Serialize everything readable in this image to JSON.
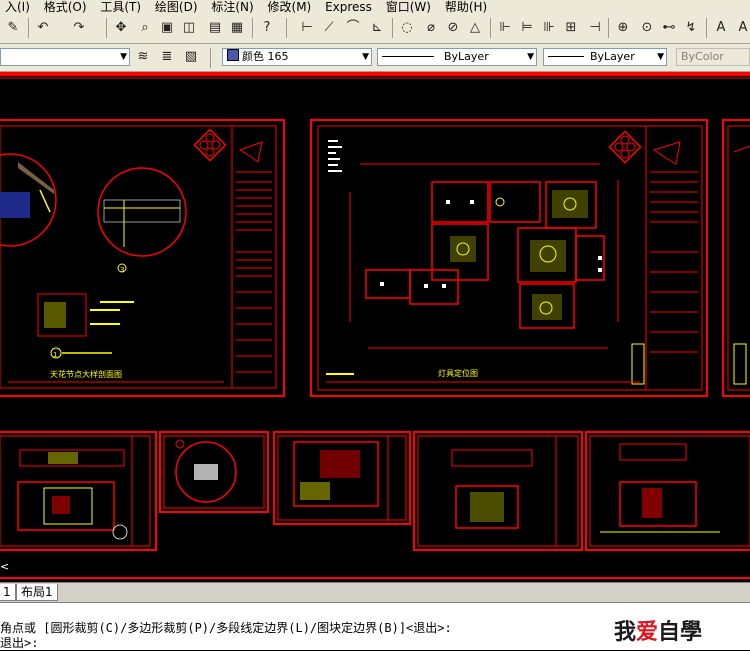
{
  "menubar": {
    "items": [
      "入(I)",
      "格式(O)",
      "工具(T)",
      "绘图(D)",
      "标注(N)",
      "修改(M)",
      "Express",
      "窗口(W)",
      "帮助(H)"
    ]
  },
  "toolbar2": {
    "color_label": "颜色 165",
    "linetype_label": "ByLayer",
    "lineweight_label": "ByLayer",
    "plotstyle_label": "ByColor"
  },
  "sheets": {
    "sheet1_title": "天花节点大样剖面图",
    "sheet2_title": "灯具定位图",
    "callout_3": "3",
    "callout_1": "1"
  },
  "tabs": {
    "tab1": "1",
    "layout1": "布局1"
  },
  "command": {
    "line1": "角点或 [圆形裁剪(C)/多边形裁剪(P)/多段线定边界(L)/图块定边界(B)]<退出>:",
    "line2": "退出>:"
  },
  "watermark": {
    "part1": "我",
    "heart": "爱",
    "part2": "自學"
  },
  "colors": {
    "cad_red": "#ff0000",
    "cad_yellow": "#ffff00",
    "cad_white": "#ffffff",
    "toolbar_bg": "#ece9d8",
    "linetype_swatch": "#4a57a8"
  }
}
